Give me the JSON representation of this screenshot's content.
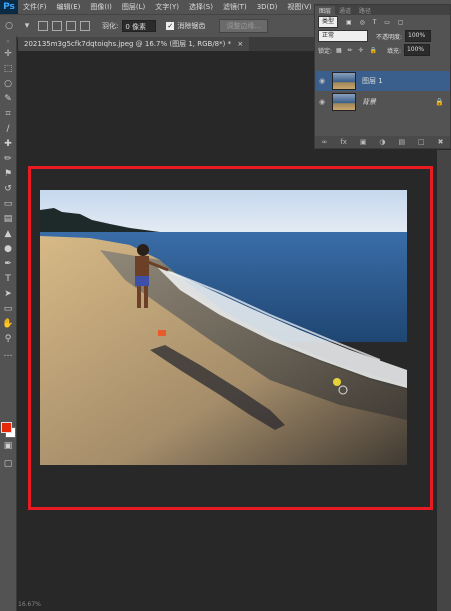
{
  "app": {
    "logo": "Ps"
  },
  "menu": [
    "文件(F)",
    "编辑(E)",
    "图像(I)",
    "图层(L)",
    "文字(Y)",
    "选择(S)",
    "滤镜(T)",
    "3D(D)",
    "视图(V)"
  ],
  "options": {
    "feather_label": "羽化:",
    "feather_value": "0 像素",
    "antialias_label": "消除锯齿",
    "refine_button": "调整边缘..."
  },
  "document": {
    "tab_title": "202135m3g5cfk7dqtoiqhs.jpeg @ 16.7% (图层 1, RGB/8*) *",
    "close_glyph": "×"
  },
  "layers_panel": {
    "tabs": [
      "图层",
      "通道",
      "路径"
    ],
    "filter_kind": "类型",
    "blend_mode": "正常",
    "opacity_label": "不透明度:",
    "opacity_value": "100%",
    "lock_label": "锁定:",
    "fill_label": "填充:",
    "fill_value": "100%",
    "layers": [
      {
        "name": "图层 1",
        "selected": true
      },
      {
        "name": "背景",
        "selected": false,
        "locked": true
      }
    ]
  },
  "colors": {
    "foreground": "#e8280a",
    "background": "#ffffff",
    "highlight_frame": "#e81b23",
    "selected_layer": "#3a5f8c"
  },
  "status": {
    "zoom": "16.67%"
  }
}
